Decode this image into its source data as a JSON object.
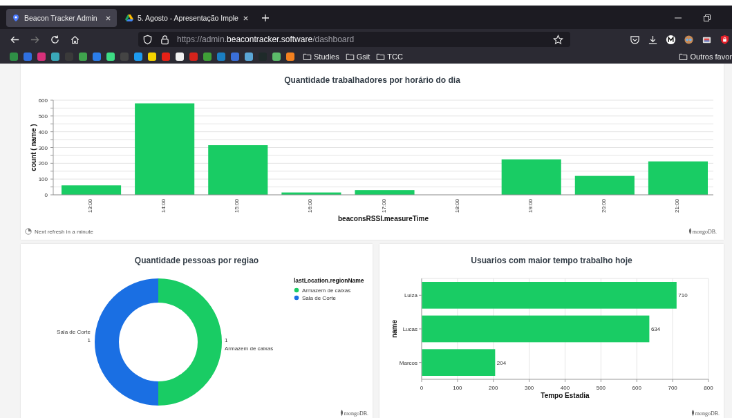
{
  "browser": {
    "tabs": [
      {
        "title": "Beacon Tracker Admin",
        "selected": true
      },
      {
        "title": "5. Agosto - Apresentação Imple",
        "selected": false
      }
    ],
    "url": {
      "host_start": "https://admin.",
      "domain": "beacontracker.software",
      "path": "/dashboard"
    },
    "bookmarks": [
      {
        "kind": "icon",
        "color": "#2f8f46"
      },
      {
        "kind": "icon",
        "color": "#2f6fe0"
      },
      {
        "kind": "icon",
        "color": "#d6307a"
      },
      {
        "kind": "icon",
        "color": "#3aa8b8"
      },
      {
        "kind": "icon",
        "color": "#3a3a3a"
      },
      {
        "kind": "icon",
        "color": "#3fa34d"
      },
      {
        "kind": "icon",
        "color": "#2b7de9"
      },
      {
        "kind": "icon",
        "color": "#3ddc84"
      },
      {
        "kind": "icon",
        "color": "#444444"
      },
      {
        "kind": "icon",
        "color": "#1d9bf0"
      },
      {
        "kind": "icon",
        "color": "#f5d300"
      },
      {
        "kind": "icon",
        "color": "#e62117"
      },
      {
        "kind": "icon",
        "color": "#f2f2f2"
      },
      {
        "kind": "icon",
        "color": "#d4231b"
      },
      {
        "kind": "icon",
        "color": "#3fa037"
      },
      {
        "kind": "icon",
        "color": "#1a7ec2"
      },
      {
        "kind": "icon",
        "color": "#3a6fd8"
      },
      {
        "kind": "icon",
        "color": "#5aa6d6"
      },
      {
        "kind": "icon",
        "color": "#1f2a2a"
      },
      {
        "kind": "icon",
        "color": "#5cba6a"
      },
      {
        "kind": "icon",
        "color": "#f4811f"
      },
      {
        "kind": "folder",
        "label": "Studies"
      },
      {
        "kind": "folder",
        "label": "Gsit"
      },
      {
        "kind": "folder",
        "label": "TCC"
      }
    ],
    "other_bookmarks": "Outros favor"
  },
  "workers_chart": {
    "chart_data": {
      "type": "bar",
      "title": "Quantidade trabalhadores por horário do dia",
      "xlabel": "beaconsRSSI.measureTime",
      "ylabel": "count ( name )",
      "categories": [
        "13:00",
        "14:00",
        "15:00",
        "16:00",
        "17:00",
        "18:00",
        "19:00",
        "20:00",
        "21:00"
      ],
      "series": [
        {
          "color": "#19cc64",
          "values": [
            60,
            580,
            315,
            15,
            30,
            0,
            225,
            120,
            212
          ]
        }
      ],
      "ylim": [
        0,
        600
      ],
      "yticks": [
        0,
        100,
        200,
        300,
        400,
        500,
        600
      ],
      "grid": true
    },
    "refresh_note": "Next refresh in a minute",
    "brand": "mongoDB."
  },
  "region_chart": {
    "chart_data": {
      "type": "donut",
      "title": "Quantidade pessoas por regiao",
      "categories": [
        "Armazem de caixas",
        "Sala de Corte"
      ],
      "series": [
        {
          "values": [
            1,
            1
          ]
        }
      ],
      "data_labels": true,
      "legend": {
        "title": "lastLocation.regionName"
      }
    },
    "slice_colors": [
      {
        "color": "#19cc64"
      },
      {
        "color": "#1a6fe3"
      }
    ],
    "brand": "mongoDB."
  },
  "users_chart": {
    "chart_data": {
      "type": "bar",
      "orientation": "horizontal",
      "title": "Usuarios com maior tempo trabalho hoje",
      "xlabel": "Tempo Estadia",
      "ylabel": "name",
      "categories": [
        "Luiza",
        "Lucas",
        "Marcos"
      ],
      "series": [
        {
          "color": "#19cc64",
          "values": [
            710,
            634,
            204
          ]
        }
      ],
      "xlim": [
        0,
        800
      ],
      "xticks": [
        0,
        100,
        200,
        300,
        400,
        500,
        600,
        700,
        800
      ],
      "data_labels": true,
      "grid": true
    },
    "brand": "mongoDB."
  }
}
